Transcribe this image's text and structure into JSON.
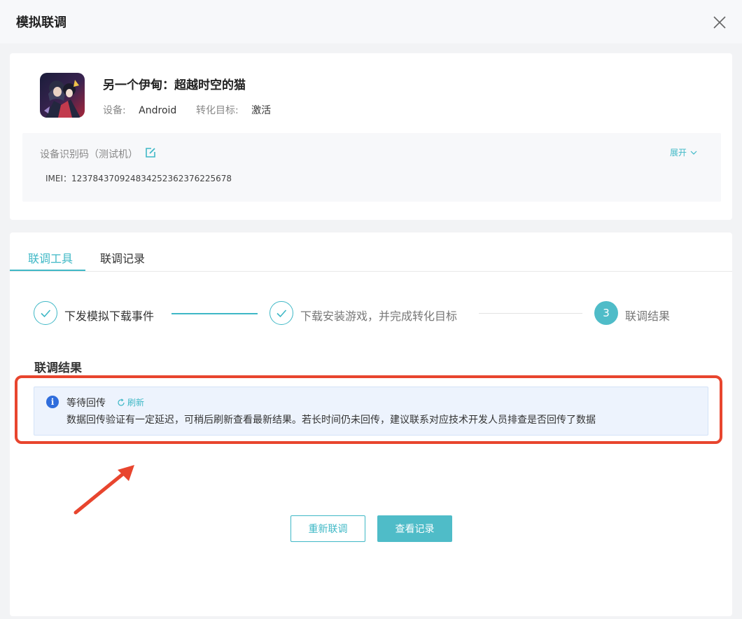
{
  "modal": {
    "title": "模拟联调"
  },
  "game": {
    "name": "另一个伊甸：超越时空的猫",
    "device_label": "设备:",
    "device_value": "Android",
    "target_label": "转化目标:",
    "target_value": "激活",
    "icon": "game-cover-icon"
  },
  "device_id": {
    "label": "设备识别码（测试机）",
    "expand_label": "展开",
    "imei": "IMEI：1237843709248342523623762256​78"
  },
  "tabs": [
    {
      "label": "联调工具",
      "active": true
    },
    {
      "label": "联调记录",
      "active": false
    }
  ],
  "steps": [
    {
      "label": "下发模拟下载事件",
      "state": "done"
    },
    {
      "label": "下载安装游戏，并完成转化目标",
      "state": "done"
    },
    {
      "label": "联调结果",
      "number": "3",
      "state": "current"
    }
  ],
  "result": {
    "title": "联调结果",
    "notice_title": "等待回传",
    "refresh_label": "刷新",
    "notice_desc": "数据回传验证有一定延迟，可稍后刷新查看最新结果。若长时间仍未回传，建议联系对应技术开发人员排查是否回传了数据"
  },
  "buttons": {
    "retry": "重新联调",
    "view_records": "查看记录"
  },
  "colors": {
    "accent": "#3fb8c6",
    "info": "#2f6ddc",
    "annotation": "#e8452e"
  }
}
